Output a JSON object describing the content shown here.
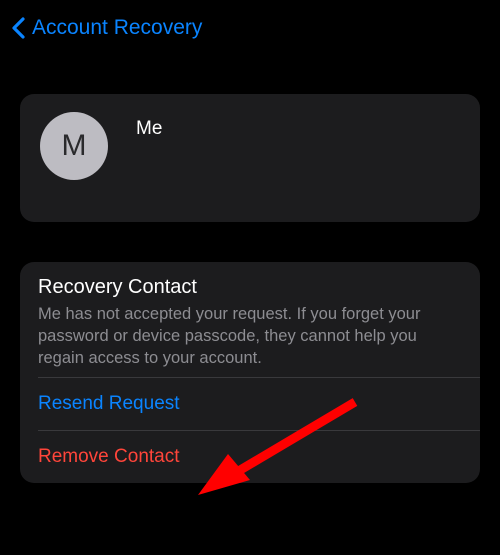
{
  "nav": {
    "back_label": "Account Recovery"
  },
  "contact": {
    "avatar_initial": "M",
    "name": "Me"
  },
  "recovery": {
    "title": "Recovery Contact",
    "description": "Me has not accepted your request. If you forget your password or device passcode, they cannot help you regain access to your account.",
    "resend_label": "Resend Request",
    "remove_label": "Remove Contact"
  },
  "colors": {
    "link_blue": "#0a84ff",
    "destructive_red": "#ff453a",
    "card_bg": "#1c1c1e",
    "secondary_text": "#8d8d92"
  }
}
